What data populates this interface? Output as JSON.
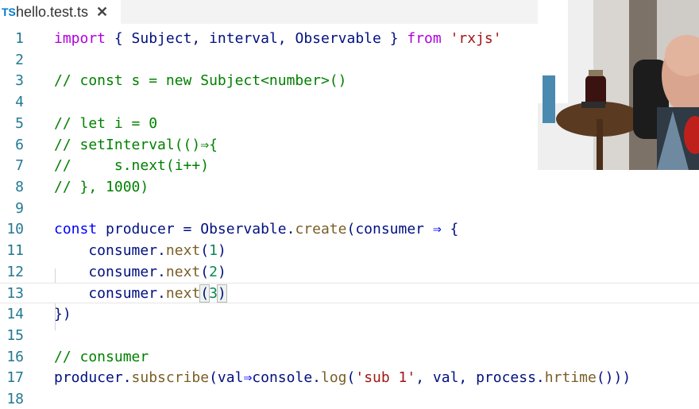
{
  "tab": {
    "icon_text": "TS",
    "filename": "hello.test.ts",
    "close_glyph": "✕"
  },
  "colors": {
    "keyword": "#af00db",
    "plain": "#001080",
    "type": "#267f99",
    "comment": "#008000",
    "string": "#a31515",
    "function": "#795e26",
    "number": "#098658",
    "operator": "#0000ff",
    "line_number": "#237893"
  },
  "editor": {
    "current_line": 13,
    "lines": [
      {
        "n": "1",
        "tokens": [
          [
            "kw",
            "import"
          ],
          [
            "p",
            " { "
          ],
          [
            "p",
            "Subject"
          ],
          [
            "p",
            ", "
          ],
          [
            "p",
            "interval"
          ],
          [
            "p",
            ", "
          ],
          [
            "p",
            "Observable"
          ],
          [
            "p",
            " } "
          ],
          [
            "kw",
            "from"
          ],
          [
            "p",
            " "
          ],
          [
            "str",
            "'rxjs'"
          ]
        ]
      },
      {
        "n": "2",
        "tokens": []
      },
      {
        "n": "3",
        "tokens": [
          [
            "cm",
            "// const s = new Subject<number>()"
          ]
        ]
      },
      {
        "n": "4",
        "tokens": []
      },
      {
        "n": "5",
        "tokens": [
          [
            "cm",
            "// let i = 0"
          ]
        ]
      },
      {
        "n": "6",
        "tokens": [
          [
            "cm",
            "// setInterval(()⇒{"
          ]
        ]
      },
      {
        "n": "7",
        "tokens": [
          [
            "cm",
            "//     s.next(i++)"
          ]
        ]
      },
      {
        "n": "8",
        "tokens": [
          [
            "cm",
            "// }, 1000)"
          ]
        ]
      },
      {
        "n": "9",
        "tokens": []
      },
      {
        "n": "10",
        "tokens": [
          [
            "op",
            "const"
          ],
          [
            "p",
            " producer = "
          ],
          [
            "p",
            "Observable"
          ],
          [
            "p",
            "."
          ],
          [
            "fn",
            "create"
          ],
          [
            "p",
            "(consumer "
          ],
          [
            "op",
            "⇒"
          ],
          [
            "p",
            " {"
          ]
        ]
      },
      {
        "n": "11",
        "tokens": [
          [
            "p",
            "    consumer."
          ],
          [
            "fn",
            "next"
          ],
          [
            "p",
            "("
          ],
          [
            "num",
            "1"
          ],
          [
            "p",
            ")"
          ]
        ]
      },
      {
        "n": "12",
        "tokens": [
          [
            "p",
            "    consumer."
          ],
          [
            "fn",
            "next"
          ],
          [
            "p",
            "("
          ],
          [
            "num",
            "2"
          ],
          [
            "p",
            ")"
          ]
        ]
      },
      {
        "n": "13",
        "tokens": [
          [
            "p",
            "    consumer."
          ],
          [
            "fn",
            "next"
          ],
          [
            "bm",
            "("
          ],
          [
            "num",
            "3"
          ],
          [
            "cursor",
            ""
          ],
          [
            "bm",
            ")"
          ]
        ]
      },
      {
        "n": "14",
        "tokens": [
          [
            "p",
            "})"
          ]
        ]
      },
      {
        "n": "15",
        "tokens": []
      },
      {
        "n": "16",
        "tokens": [
          [
            "cm",
            "// consumer"
          ]
        ]
      },
      {
        "n": "17",
        "tokens": [
          [
            "p",
            "producer."
          ],
          [
            "fn",
            "subscribe"
          ],
          [
            "p",
            "(val"
          ],
          [
            "op",
            "⇒"
          ],
          [
            "p",
            "console."
          ],
          [
            "fn",
            "log"
          ],
          [
            "p",
            "("
          ],
          [
            "str",
            "'sub 1'"
          ],
          [
            "p",
            ", val, process."
          ],
          [
            "fn",
            "hrtime"
          ],
          [
            "p",
            "()))"
          ]
        ]
      },
      {
        "n": "18",
        "tokens": []
      }
    ]
  }
}
